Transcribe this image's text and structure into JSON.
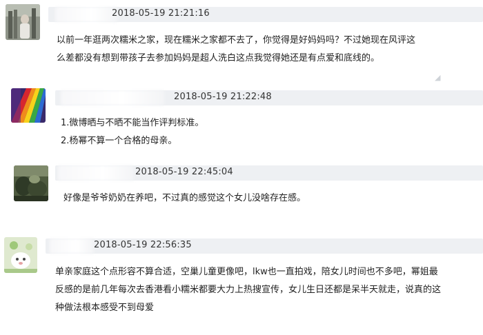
{
  "comments": [
    {
      "timestamp": "2018-05-19 21:21:16",
      "lines": [
        "以前一年逛两次糯米之家，现在糯米之家都不去了，你觉得是好妈妈吗？不过她现在风评这",
        "么差都没有想到带孩子去参加妈妈是超人洗白这点我觉得她还是有点爱和底线的。"
      ]
    },
    {
      "timestamp": "2018-05-19 21:22:48",
      "lines": [
        "1.微博晒与不晒不能当作评判标准。",
        "2.杨幂不算一个合格的母亲。"
      ]
    },
    {
      "timestamp": "2018-05-19 22:45:04",
      "lines": [
        "好像是爷爷奶奶在养吧，不过真的感觉这个女儿没啥存在感。"
      ]
    },
    {
      "timestamp": "2018-05-19 22:56:35",
      "lines": [
        "单亲家庭这个点形容不算合适，空巢儿童更像吧，lkw也一直拍戏，陪女儿时间也不多吧，幂姐最",
        "反感的是前几年每次去香港看小糯米都要大力上热搜宣传，女儿生日还都是呆半天就走，说真的这",
        "种做法根本感受不到母爱"
      ]
    }
  ],
  "colors": {
    "header_bar": "#eef0f3",
    "text": "#1f1f1f"
  }
}
